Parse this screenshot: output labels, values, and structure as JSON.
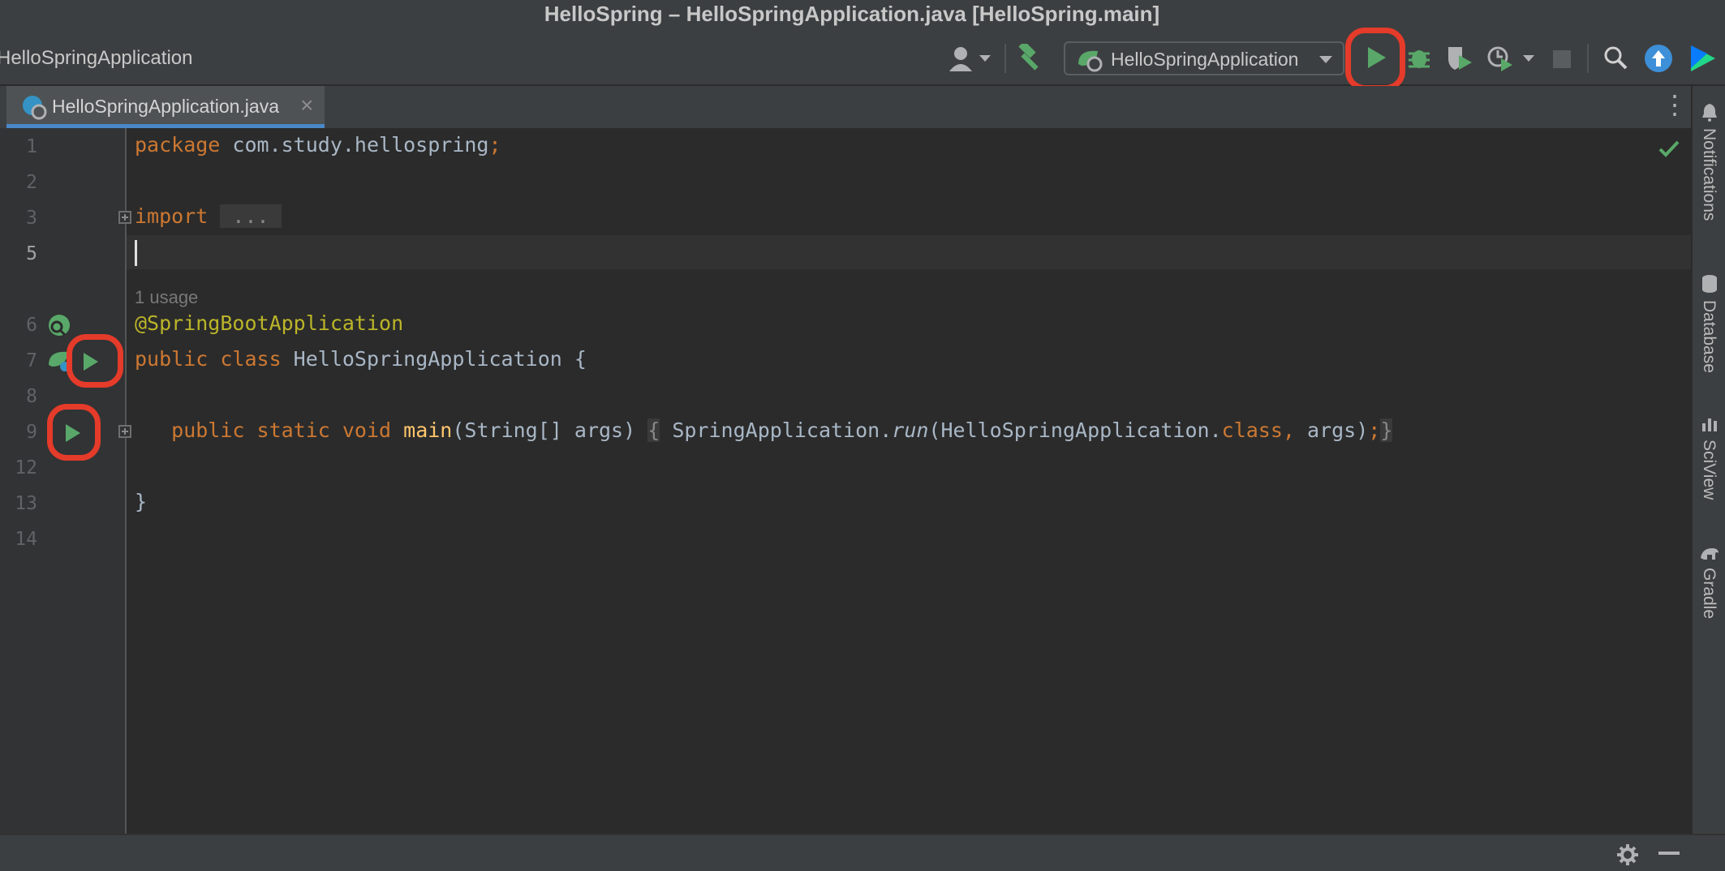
{
  "window": {
    "title": "HelloSpring – HelloSpringApplication.java [HelloSpring.main]"
  },
  "toolbar": {
    "breadcrumb": "HelloSpringApplication",
    "run_config": "HelloSpringApplication",
    "icons": [
      "user-icon",
      "hammer-icon",
      "spring-boot-icon",
      "run-icon",
      "debug-icon",
      "coverage-icon",
      "profiler-icon",
      "stop-icon",
      "search-icon",
      "update-icon",
      "jetbrains-icon"
    ]
  },
  "tabs": [
    {
      "label": "HelloSpringApplication.java",
      "active": true
    }
  ],
  "editor": {
    "line_numbers": [
      "1",
      "2",
      "3",
      "5",
      "6",
      "7",
      "8",
      "9",
      "12",
      "13",
      "14"
    ],
    "lines": {
      "l1_kw": "package",
      "l1_rest": " com.study.hellospring",
      "l1_semi": ";",
      "l3_kw": "import",
      "l3_fold": " ... ",
      "usage": "1 usage",
      "l6_ann": "@SpringBootApplication",
      "l7_kw": "public class",
      "l7_rest": " HelloSpringApplication {",
      "l9_kw": "public static void",
      "l9_fn": "main",
      "l9_args": "(String[] args)",
      "l9_open": "{",
      "l9_cls": " SpringApplication.",
      "l9_run": "run",
      "l9_call": "(HelloSpringApplication.",
      "l9_classkw": "class,",
      "l9_end": " args)",
      "l9_semi": ";",
      "l9_close": "}",
      "l13": "}"
    }
  },
  "right_sidebar": [
    "Notifications",
    "Database",
    "SciView",
    "Gradle"
  ],
  "colors": {
    "accent_highlight": "#e53b2a",
    "run_green": "#59a869",
    "keyword": "#cc7832",
    "annotation": "#bbb529",
    "method": "#ffc66d"
  }
}
